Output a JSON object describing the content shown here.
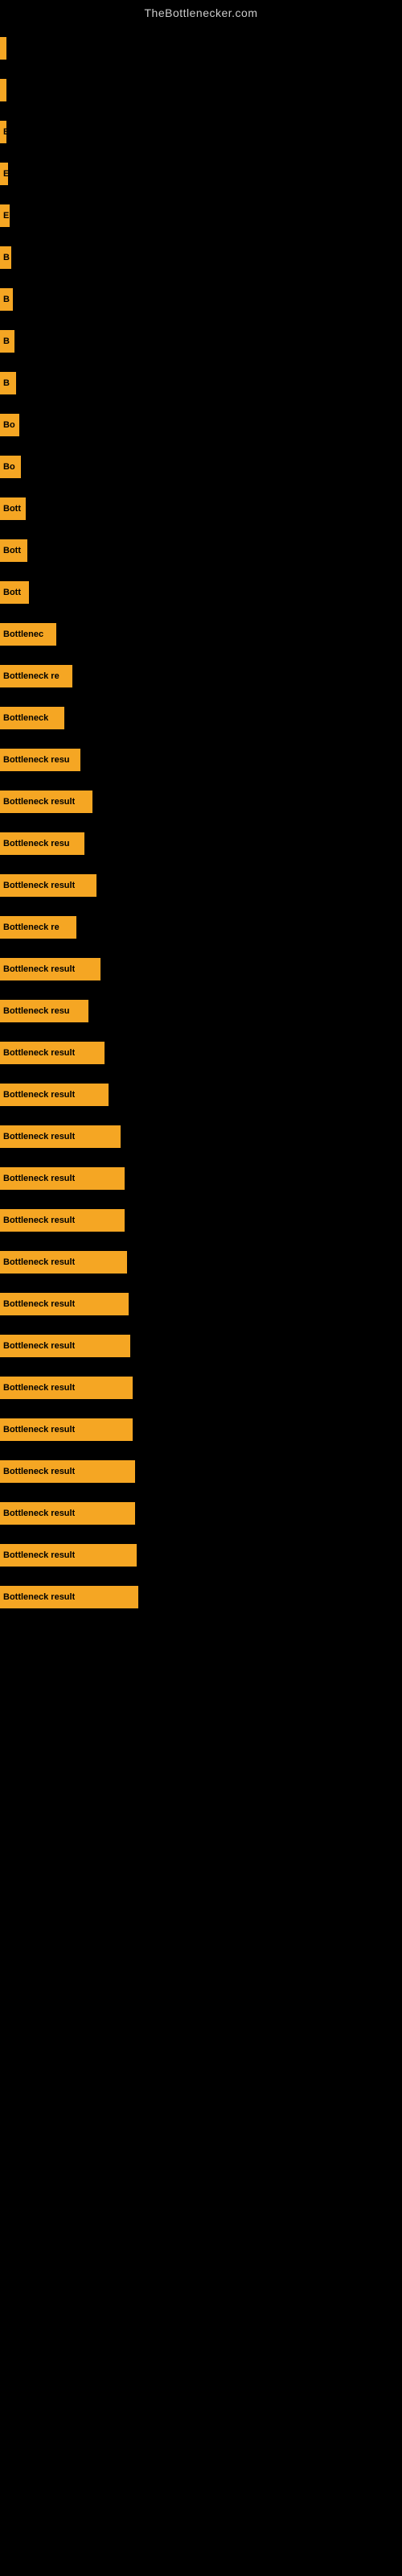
{
  "site": {
    "title": "TheBottlenecker.com"
  },
  "bars": [
    {
      "label": "",
      "width": 4
    },
    {
      "label": "",
      "width": 4
    },
    {
      "label": "E",
      "width": 8
    },
    {
      "label": "E",
      "width": 10
    },
    {
      "label": "E",
      "width": 12
    },
    {
      "label": "B",
      "width": 14
    },
    {
      "label": "B",
      "width": 16
    },
    {
      "label": "B",
      "width": 18
    },
    {
      "label": "B",
      "width": 20
    },
    {
      "label": "Bo",
      "width": 24
    },
    {
      "label": "Bo",
      "width": 26
    },
    {
      "label": "Bott",
      "width": 32
    },
    {
      "label": "Bott",
      "width": 34
    },
    {
      "label": "Bott",
      "width": 36
    },
    {
      "label": "Bottlenec",
      "width": 70
    },
    {
      "label": "Bottleneck re",
      "width": 90
    },
    {
      "label": "Bottleneck",
      "width": 80
    },
    {
      "label": "Bottleneck resu",
      "width": 100
    },
    {
      "label": "Bottleneck result",
      "width": 115
    },
    {
      "label": "Bottleneck resu",
      "width": 105
    },
    {
      "label": "Bottleneck result",
      "width": 120
    },
    {
      "label": "Bottleneck re",
      "width": 95
    },
    {
      "label": "Bottleneck result",
      "width": 125
    },
    {
      "label": "Bottleneck resu",
      "width": 110
    },
    {
      "label": "Bottleneck result",
      "width": 130
    },
    {
      "label": "Bottleneck result",
      "width": 135
    },
    {
      "label": "Bottleneck result",
      "width": 150
    },
    {
      "label": "Bottleneck result",
      "width": 155
    },
    {
      "label": "Bottleneck result",
      "width": 155
    },
    {
      "label": "Bottleneck result",
      "width": 158
    },
    {
      "label": "Bottleneck result",
      "width": 160
    },
    {
      "label": "Bottleneck result",
      "width": 162
    },
    {
      "label": "Bottleneck result",
      "width": 165
    },
    {
      "label": "Bottleneck result",
      "width": 165
    },
    {
      "label": "Bottleneck result",
      "width": 168
    },
    {
      "label": "Bottleneck result",
      "width": 168
    },
    {
      "label": "Bottleneck result",
      "width": 170
    },
    {
      "label": "Bottleneck result",
      "width": 172
    }
  ]
}
